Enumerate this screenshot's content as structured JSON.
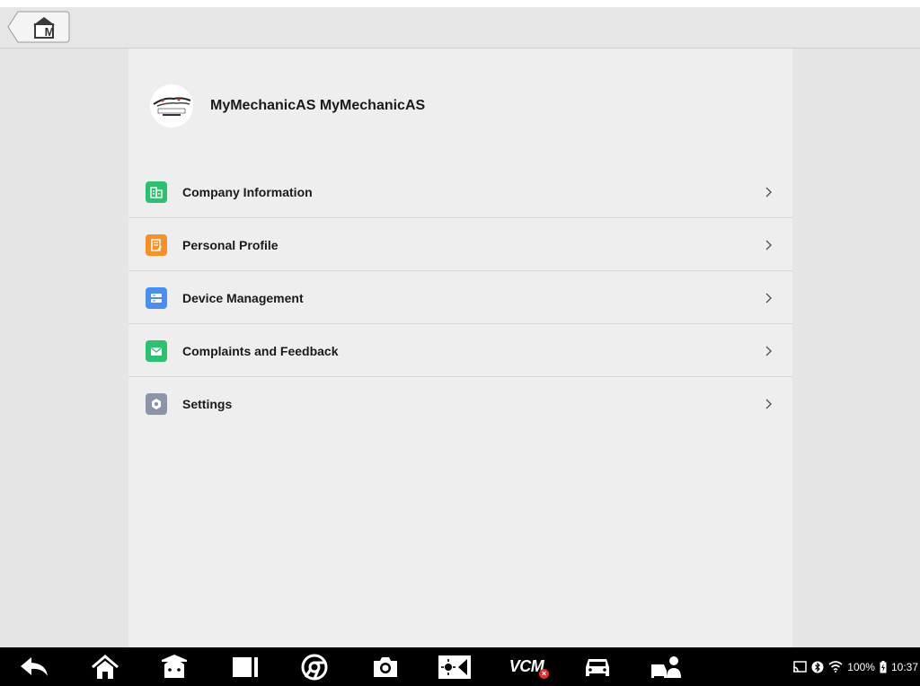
{
  "header": {
    "home_letter": "M"
  },
  "profile": {
    "name": "MyMechanicAS MyMechanicAS",
    "avatar_logo_text": "MYMECHANIC"
  },
  "menu": {
    "items": [
      {
        "label": "Company Information",
        "icon": "building-icon",
        "color": "#2fbf71"
      },
      {
        "label": "Personal Profile",
        "icon": "profile-icon",
        "color": "#f5902b"
      },
      {
        "label": "Device Management",
        "icon": "device-icon",
        "color": "#4a8ef0"
      },
      {
        "label": "Complaints and Feedback",
        "icon": "mail-icon",
        "color": "#2fbf71"
      },
      {
        "label": "Settings",
        "icon": "gear-icon",
        "color": "#8c95a8"
      }
    ]
  },
  "navbar": {
    "vcm_label": "VCM",
    "vcm_status": "×"
  },
  "status": {
    "battery": "100%",
    "time": "10:37"
  }
}
